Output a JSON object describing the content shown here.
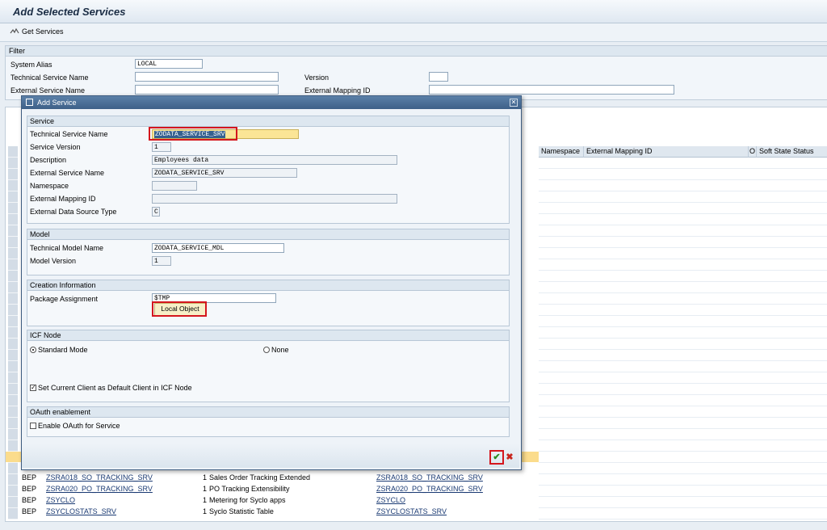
{
  "page": {
    "title": "Add Selected Services"
  },
  "toolbar": {
    "get_services_label": "Get Services"
  },
  "filter": {
    "header": "Filter",
    "system_alias_label": "System Alias",
    "system_alias_value": "LOCAL",
    "technical_service_name_label": "Technical Service Name",
    "version_label": "Version",
    "external_service_name_label": "External Service Name",
    "external_mapping_id_label": "External Mapping ID"
  },
  "grid": {
    "columns": {
      "namespace": "Namespace",
      "external_mapping_id": "External Mapping ID",
      "o": "O",
      "soft_state_status": "Soft State Status"
    },
    "rows": [
      {
        "type": "BEP",
        "technical_name": "ZSRA018_SO_TRACKING_SRV",
        "version": "1",
        "description": "Sales Order Tracking Extended",
        "external_name": "ZSRA018_SO_TRACKING_SRV"
      },
      {
        "type": "BEP",
        "technical_name": "ZSRA020_PO_TRACKING_SRV",
        "version": "1",
        "description": "PO Tracking Extensibility",
        "external_name": "ZSRA020_PO_TRACKING_SRV"
      },
      {
        "type": "BEP",
        "technical_name": "ZSYCLO",
        "version": "1",
        "description": "Metering for Syclo apps",
        "external_name": "ZSYCLO"
      },
      {
        "type": "BEP",
        "technical_name": "ZSYCLOSTATS_SRV",
        "version": "1",
        "description": "Syclo Statistic Table",
        "external_name": "ZSYCLOSTATS_SRV"
      }
    ]
  },
  "dialog": {
    "title": "Add Service",
    "service": {
      "header": "Service",
      "technical_service_name_label": "Technical Service Name",
      "technical_service_name_value": "ZODATA_SERVICE_SRV",
      "service_version_label": "Service Version",
      "service_version_value": "1",
      "description_label": "Description",
      "description_value": "Employees data",
      "external_service_name_label": "External Service Name",
      "external_service_name_value": "ZODATA_SERVICE_SRV",
      "namespace_label": "Namespace",
      "external_mapping_id_label": "External Mapping ID",
      "external_data_source_type_label": "External Data Source Type",
      "external_data_source_type_value": "C"
    },
    "model": {
      "header": "Model",
      "technical_model_name_label": "Technical Model Name",
      "technical_model_name_value": "ZODATA_SERVICE_MDL",
      "model_version_label": "Model Version",
      "model_version_value": "1"
    },
    "creation": {
      "header": "Creation Information",
      "package_assignment_label": "Package Assignment",
      "package_assignment_value": "$TMP",
      "local_object_label": "Local Object"
    },
    "icf": {
      "header": "ICF Node",
      "standard_mode_label": "Standard Mode",
      "none_label": "None",
      "set_client_label": "Set Current Client as Default Client in ICF Node"
    },
    "oauth": {
      "header": "OAuth enablement",
      "enable_label": "Enable OAuth for Service"
    }
  }
}
